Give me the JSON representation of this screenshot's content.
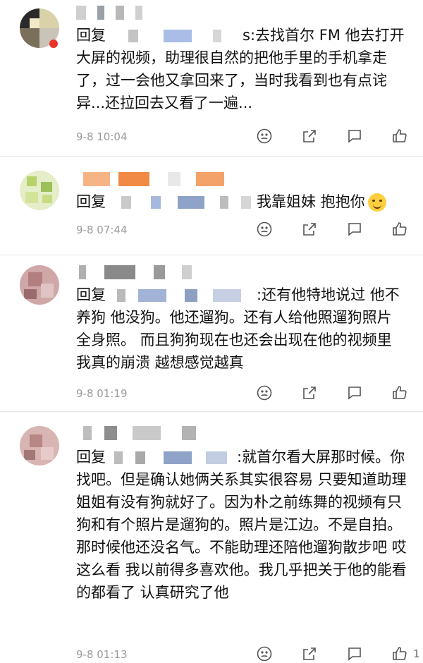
{
  "comments": [
    {
      "reply_prefix": "回复",
      "name_tail": "s",
      "text_after": ":去找首尔 FM 他去打开大屏的视频，助理很自然的把他手里的手机拿走了，过一会他又拿回来了，当时我看到也有点诧异...还拉回去又看了一遍...",
      "timestamp": "9-8 10:04",
      "like_count": ""
    },
    {
      "reply_prefix": "回复",
      "text_after": "我靠姐妹 抱抱你",
      "emoji": "hug-emoji",
      "timestamp": "9-8 07:44",
      "like_count": ""
    },
    {
      "reply_prefix": "回复",
      "text_after": ":还有他特地说过 他不养狗 他没狗。他还遛狗。还有人给他照遛狗照片 全身照。 而且狗狗现在也还会出现在他的视频里 我真的崩溃 越想感觉越真",
      "timestamp": "9-8 01:19",
      "like_count": ""
    },
    {
      "reply_prefix": "回复",
      "text_after": ":就首尔看大屏那时候。你找吧。但是确认她俩关系其实很容易 只要知道助理姐姐有没有狗就好了。因为朴之前练舞的视频有只狗和有个照片是遛狗的。照片是江边。不是自拍。那时候他还没名气。不能助理还陪他遛狗散步吧 哎这么看 我以前得多喜欢他。我几乎把关于他的能看的都看了 认真研究了他",
      "timestamp": "9-8 01:13",
      "like_count": "1"
    }
  ],
  "icons": {
    "react": "face-icon",
    "share": "share-icon",
    "comment": "comment-icon",
    "like": "thumbs-up-icon"
  },
  "colors": {
    "text": "#111111",
    "meta": "#9a9a9a",
    "divider": "#e6e6e6",
    "redaction_blue": "#9db3dc",
    "redaction_gray": "#bfbfbf"
  }
}
